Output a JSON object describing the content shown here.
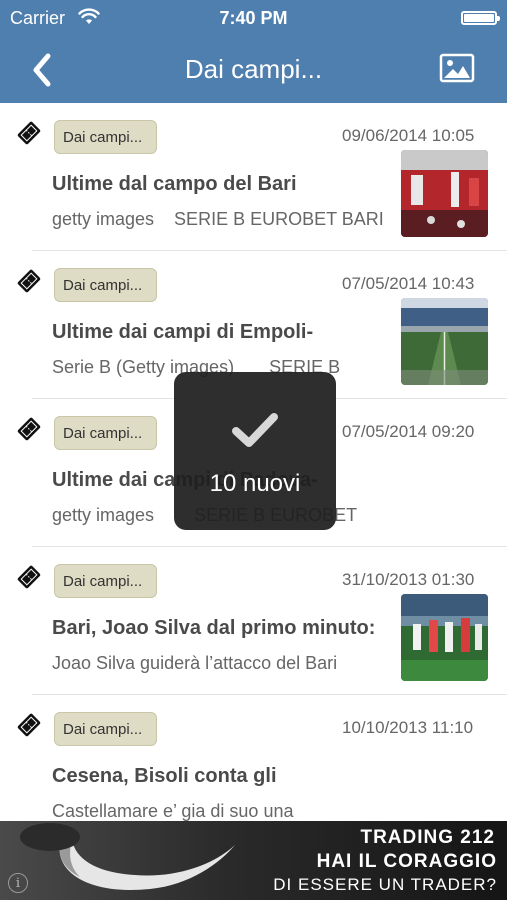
{
  "status_bar": {
    "carrier": "Carrier",
    "time": "7:40 PM",
    "wifi_icon": "wifi-icon",
    "battery_icon": "battery-icon"
  },
  "nav": {
    "title": "Dai campi...",
    "back_icon": "chevron-left-icon",
    "gallery_icon": "image-icon",
    "background_color": "#4f7fae"
  },
  "items": [
    {
      "badge": "Dai campi...",
      "date": "09/06/2014  10:05",
      "headline": "Ultime dal campo del Bari",
      "summary": "getty images    SERIE B EUROBET BARI",
      "has_thumb": true
    },
    {
      "badge": "Dai campi...",
      "date": "07/05/2014  10:43",
      "headline": "Ultime dai campi di Empoli-",
      "summary": "Serie B (Getty images)       SERIE B",
      "has_thumb": true
    },
    {
      "badge": "Dai campi...",
      "date": "07/05/2014  09:20",
      "headline": "Ultime dai campi di Padova-",
      "summary": "getty images        SERIE B EUROBET",
      "has_thumb": false
    },
    {
      "badge": "Dai campi...",
      "date": "31/10/2013  01:30",
      "headline": "Bari, Joao Silva dal primo minuto:",
      "summary": "Joao Silva guiderà l’attacco del Bari",
      "has_thumb": true
    },
    {
      "badge": "Dai campi...",
      "date": "10/10/2013  11:10",
      "headline": "Cesena, Bisoli conta gli",
      "summary": "Castellamare e’ gia di suo una",
      "has_thumb": false
    }
  ],
  "toast": {
    "message": "10 nuovi",
    "icon": "checkmark-icon"
  },
  "ad": {
    "brand": "TRADING 212",
    "line1": "HAI IL CORAGGIO",
    "line2": "DI ESSERE UN TRADER?",
    "info": "i"
  }
}
